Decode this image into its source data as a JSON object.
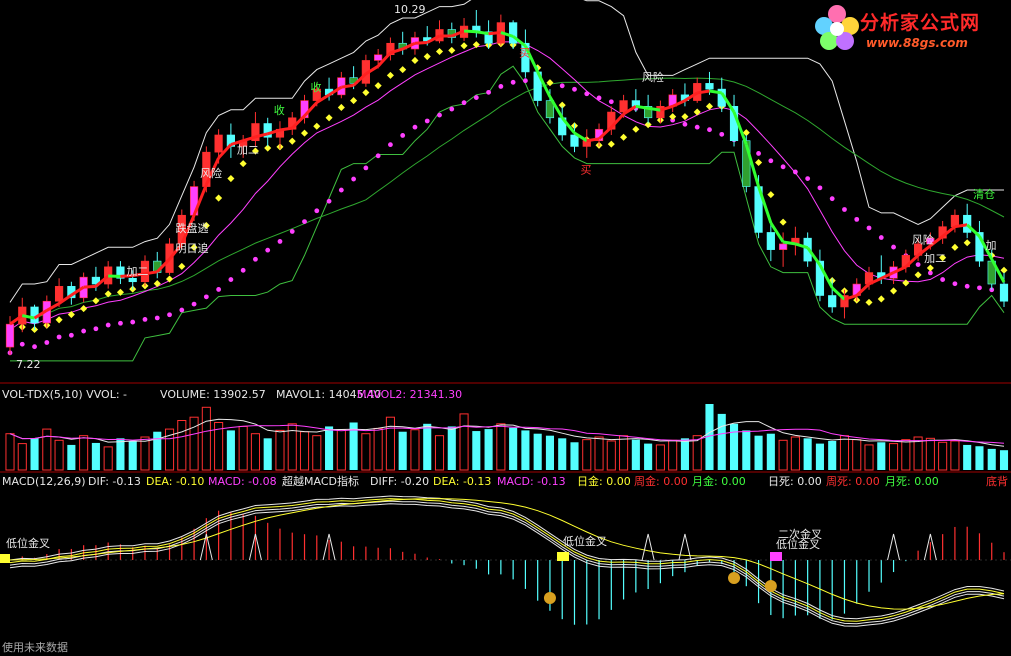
{
  "logo": {
    "title": "分析家公式网",
    "url": "www.88gs.com"
  },
  "main_panel": {
    "high_price_label": "10.29",
    "low_price_label": "7.22",
    "signals": {
      "risk": "风险",
      "chase": "追",
      "avoid": "逃",
      "add_two": "加二",
      "add": "加",
      "buy": "买",
      "buy_alt": "买",
      "clear": "清仓",
      "receive": "收",
      "tomorrow_chase": "明日追",
      "bearish_escape": "跌盘逃"
    }
  },
  "volume_panel": {
    "header_prefix": "VOL-TDX(5,10)  VVOL: -",
    "volume_label": "VOLUME: 13902.57",
    "mavol1_label": "MAVOL1: 14045.40",
    "mavol2_label": "MAVOL2: 21341.30"
  },
  "macd_panel": {
    "name": "MACD(12,26,9)",
    "dif": "DIF: -0.13",
    "dea": "DEA: -0.10",
    "macd": "MACD: -0.08",
    "indicator": "超越MACD指标",
    "diff2": "DIFF: -0.20",
    "dea2": "DEA: -0.13",
    "macd2": "MACD: -0.13",
    "day_gold": "日金: 0.00",
    "week_gold": "周金: 0.00",
    "month_gold": "月金: 0.00",
    "day_dead": "日死: 0.00",
    "week_dead": "周死: 0.00",
    "month_dead": "月死: 0.00",
    "bottom_div": "底背",
    "low_gold_cross": "低位金叉",
    "second_gold_cross": "二次金叉",
    "footer": "使用未来数据"
  },
  "colors": {
    "up": "#ff3030",
    "down": "#54ffff",
    "magenta": "#ff40ff",
    "yellow": "#ffff30",
    "green": "#40ff40",
    "white": "#e8e8e8",
    "divider": "#a00000",
    "zigzag": "#3fbf3f"
  },
  "chart_data": {
    "type": "candlestick",
    "price_range": [
      7.22,
      10.29
    ],
    "candles": [
      [
        7.35,
        7.62,
        7.28,
        7.55
      ],
      [
        7.55,
        7.78,
        7.48,
        7.7
      ],
      [
        7.7,
        7.72,
        7.5,
        7.56
      ],
      [
        7.56,
        7.8,
        7.52,
        7.75
      ],
      [
        7.75,
        7.95,
        7.7,
        7.88
      ],
      [
        7.88,
        7.92,
        7.72,
        7.78
      ],
      [
        7.78,
        8.0,
        7.74,
        7.96
      ],
      [
        7.96,
        8.05,
        7.84,
        7.9
      ],
      [
        7.9,
        8.1,
        7.86,
        8.05
      ],
      [
        8.05,
        8.1,
        7.9,
        7.95
      ],
      [
        7.95,
        8.02,
        7.85,
        7.92
      ],
      [
        7.92,
        8.15,
        7.88,
        8.1
      ],
      [
        8.1,
        8.18,
        7.95,
        8.0
      ],
      [
        8.0,
        8.3,
        7.98,
        8.25
      ],
      [
        8.25,
        8.55,
        8.2,
        8.5
      ],
      [
        8.5,
        8.8,
        8.45,
        8.75
      ],
      [
        8.75,
        9.1,
        8.7,
        9.05
      ],
      [
        9.05,
        9.25,
        8.95,
        9.2
      ],
      [
        9.2,
        9.3,
        9.0,
        9.1
      ],
      [
        9.1,
        9.2,
        9.0,
        9.15
      ],
      [
        9.15,
        9.4,
        9.1,
        9.3
      ],
      [
        9.3,
        9.35,
        9.1,
        9.18
      ],
      [
        9.18,
        9.32,
        9.08,
        9.25
      ],
      [
        9.25,
        9.4,
        9.2,
        9.35
      ],
      [
        9.35,
        9.55,
        9.3,
        9.5
      ],
      [
        9.5,
        9.65,
        9.45,
        9.6
      ],
      [
        9.6,
        9.7,
        9.5,
        9.55
      ],
      [
        9.55,
        9.75,
        9.52,
        9.7
      ],
      [
        9.7,
        9.8,
        9.6,
        9.65
      ],
      [
        9.65,
        9.9,
        9.62,
        9.85
      ],
      [
        9.85,
        9.95,
        9.78,
        9.9
      ],
      [
        9.9,
        10.05,
        9.85,
        10.0
      ],
      [
        10.0,
        10.1,
        9.9,
        9.95
      ],
      [
        9.95,
        10.1,
        9.9,
        10.05
      ],
      [
        10.05,
        10.15,
        9.98,
        10.02
      ],
      [
        10.02,
        10.2,
        10.0,
        10.12
      ],
      [
        10.12,
        10.18,
        10.0,
        10.05
      ],
      [
        10.05,
        10.22,
        10.02,
        10.15
      ],
      [
        10.15,
        10.29,
        10.05,
        10.1
      ],
      [
        10.1,
        10.2,
        9.95,
        10.0
      ],
      [
        10.0,
        10.25,
        9.98,
        10.18
      ],
      [
        10.18,
        10.2,
        9.95,
        10.0
      ],
      [
        10.0,
        10.12,
        9.7,
        9.75
      ],
      [
        9.75,
        9.8,
        9.45,
        9.5
      ],
      [
        9.5,
        9.6,
        9.3,
        9.35
      ],
      [
        9.35,
        9.45,
        9.15,
        9.2
      ],
      [
        9.2,
        9.3,
        9.05,
        9.1
      ],
      [
        9.1,
        9.25,
        9.0,
        9.15
      ],
      [
        9.15,
        9.3,
        9.1,
        9.25
      ],
      [
        9.25,
        9.45,
        9.2,
        9.4
      ],
      [
        9.4,
        9.55,
        9.35,
        9.5
      ],
      [
        9.5,
        9.6,
        9.4,
        9.45
      ],
      [
        9.45,
        9.55,
        9.3,
        9.35
      ],
      [
        9.35,
        9.5,
        9.3,
        9.45
      ],
      [
        9.45,
        9.6,
        9.4,
        9.55
      ],
      [
        9.55,
        9.65,
        9.45,
        9.5
      ],
      [
        9.5,
        9.7,
        9.48,
        9.65
      ],
      [
        9.65,
        9.75,
        9.55,
        9.6
      ],
      [
        9.6,
        9.7,
        9.4,
        9.45
      ],
      [
        9.45,
        9.55,
        9.1,
        9.15
      ],
      [
        9.15,
        9.2,
        8.7,
        8.75
      ],
      [
        8.75,
        8.85,
        8.3,
        8.35
      ],
      [
        8.35,
        8.45,
        8.1,
        8.2
      ],
      [
        8.2,
        8.35,
        8.05,
        8.25
      ],
      [
        8.25,
        8.4,
        8.15,
        8.3
      ],
      [
        8.3,
        8.35,
        8.05,
        8.1
      ],
      [
        8.1,
        8.2,
        7.75,
        7.8
      ],
      [
        7.8,
        7.95,
        7.65,
        7.7
      ],
      [
        7.7,
        7.85,
        7.6,
        7.8
      ],
      [
        7.8,
        7.95,
        7.75,
        7.9
      ],
      [
        7.9,
        8.05,
        7.85,
        8.0
      ],
      [
        8.0,
        8.15,
        7.9,
        7.95
      ],
      [
        7.95,
        8.1,
        7.9,
        8.05
      ],
      [
        8.05,
        8.2,
        8.0,
        8.15
      ],
      [
        8.15,
        8.3,
        8.1,
        8.25
      ],
      [
        8.25,
        8.35,
        8.2,
        8.3
      ],
      [
        8.3,
        8.45,
        8.25,
        8.4
      ],
      [
        8.4,
        8.55,
        8.35,
        8.5
      ],
      [
        8.5,
        8.6,
        8.3,
        8.35
      ],
      [
        8.35,
        8.45,
        8.05,
        8.1
      ],
      [
        8.1,
        8.2,
        7.85,
        7.9
      ],
      [
        7.9,
        8.0,
        7.7,
        7.75
      ]
    ],
    "volume": [
      0.55,
      0.4,
      0.48,
      0.62,
      0.45,
      0.38,
      0.52,
      0.41,
      0.35,
      0.48,
      0.44,
      0.5,
      0.58,
      0.62,
      0.75,
      0.8,
      0.95,
      0.72,
      0.6,
      0.66,
      0.55,
      0.48,
      0.6,
      0.7,
      0.58,
      0.52,
      0.66,
      0.61,
      0.72,
      0.55,
      0.63,
      0.8,
      0.58,
      0.61,
      0.7,
      0.52,
      0.66,
      0.85,
      0.59,
      0.62,
      0.7,
      0.64,
      0.6,
      0.55,
      0.52,
      0.48,
      0.42,
      0.46,
      0.5,
      0.44,
      0.52,
      0.46,
      0.4,
      0.38,
      0.45,
      0.48,
      0.52,
      1.0,
      0.85,
      0.7,
      0.6,
      0.52,
      0.55,
      0.45,
      0.5,
      0.48,
      0.4,
      0.44,
      0.52,
      0.46,
      0.38,
      0.42,
      0.4,
      0.46,
      0.5,
      0.48,
      0.42,
      0.44,
      0.38,
      0.36,
      0.32,
      0.3
    ]
  }
}
